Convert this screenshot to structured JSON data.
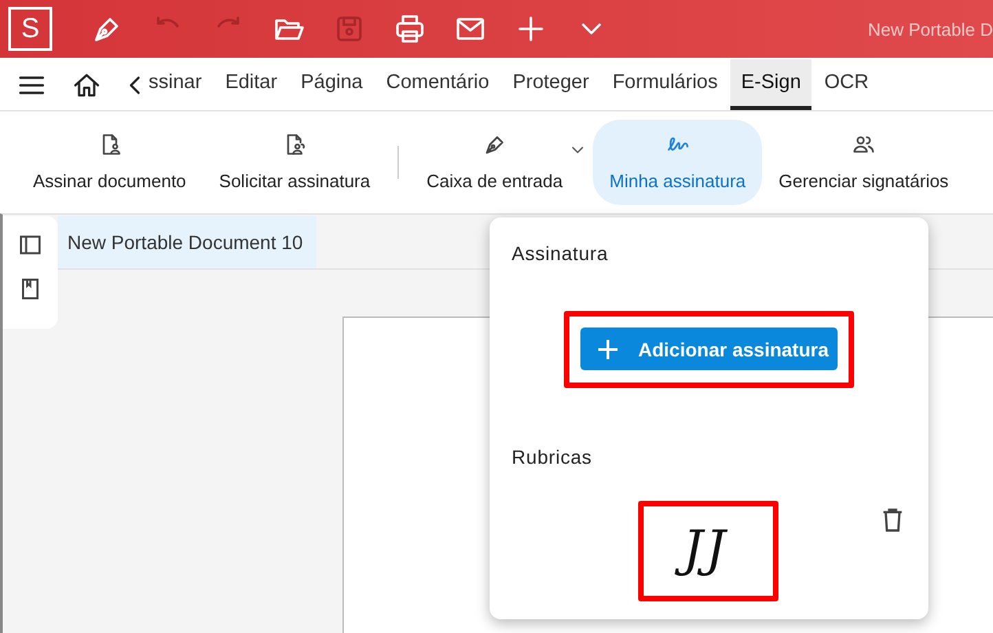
{
  "title_bar": {
    "logo": "S",
    "title": "New Portable D",
    "quick_actions": [
      {
        "kind": "pen",
        "disabled": false
      },
      {
        "kind": "undo",
        "disabled": true
      },
      {
        "kind": "redo",
        "disabled": true
      },
      {
        "kind": "folder",
        "disabled": false
      },
      {
        "kind": "save",
        "disabled": true
      },
      {
        "kind": "print",
        "disabled": false
      },
      {
        "kind": "mail",
        "disabled": false
      },
      {
        "kind": "plus",
        "disabled": false
      },
      {
        "kind": "chevron",
        "disabled": false
      }
    ]
  },
  "menu_bar": {
    "tabs": [
      {
        "label": "ssinar",
        "selected": false
      },
      {
        "label": "Editar",
        "selected": false
      },
      {
        "label": "Página",
        "selected": false
      },
      {
        "label": "Comentário",
        "selected": false
      },
      {
        "label": "Proteger",
        "selected": false
      },
      {
        "label": "Formulários",
        "selected": false
      },
      {
        "label": "E-Sign",
        "selected": true
      },
      {
        "label": "OCR",
        "selected": false
      }
    ]
  },
  "toolbar": {
    "items": [
      {
        "kind": "sign-doc",
        "label": "Assinar documento",
        "selected": false,
        "dropdown": false
      },
      {
        "kind": "request",
        "label": "Solicitar assinatura",
        "selected": false,
        "dropdown": false
      },
      {
        "kind": "pen",
        "label": "Caixa de entrada",
        "selected": false,
        "dropdown": true
      },
      {
        "kind": "signature",
        "label": "Minha assinatura",
        "selected": true,
        "dropdown": false
      },
      {
        "kind": "people",
        "label": "Gerenciar signatários",
        "selected": false,
        "dropdown": false
      }
    ]
  },
  "document_tab": {
    "label": "New Portable Document 10",
    "selected": true
  },
  "signature_popup": {
    "signature_heading": "Assinatura",
    "add_button": {
      "label": "Adicionar assinatura",
      "highlighted": true
    },
    "initials_heading": "Rubricas",
    "initials": {
      "text": "JJ",
      "highlighted": true
    }
  }
}
